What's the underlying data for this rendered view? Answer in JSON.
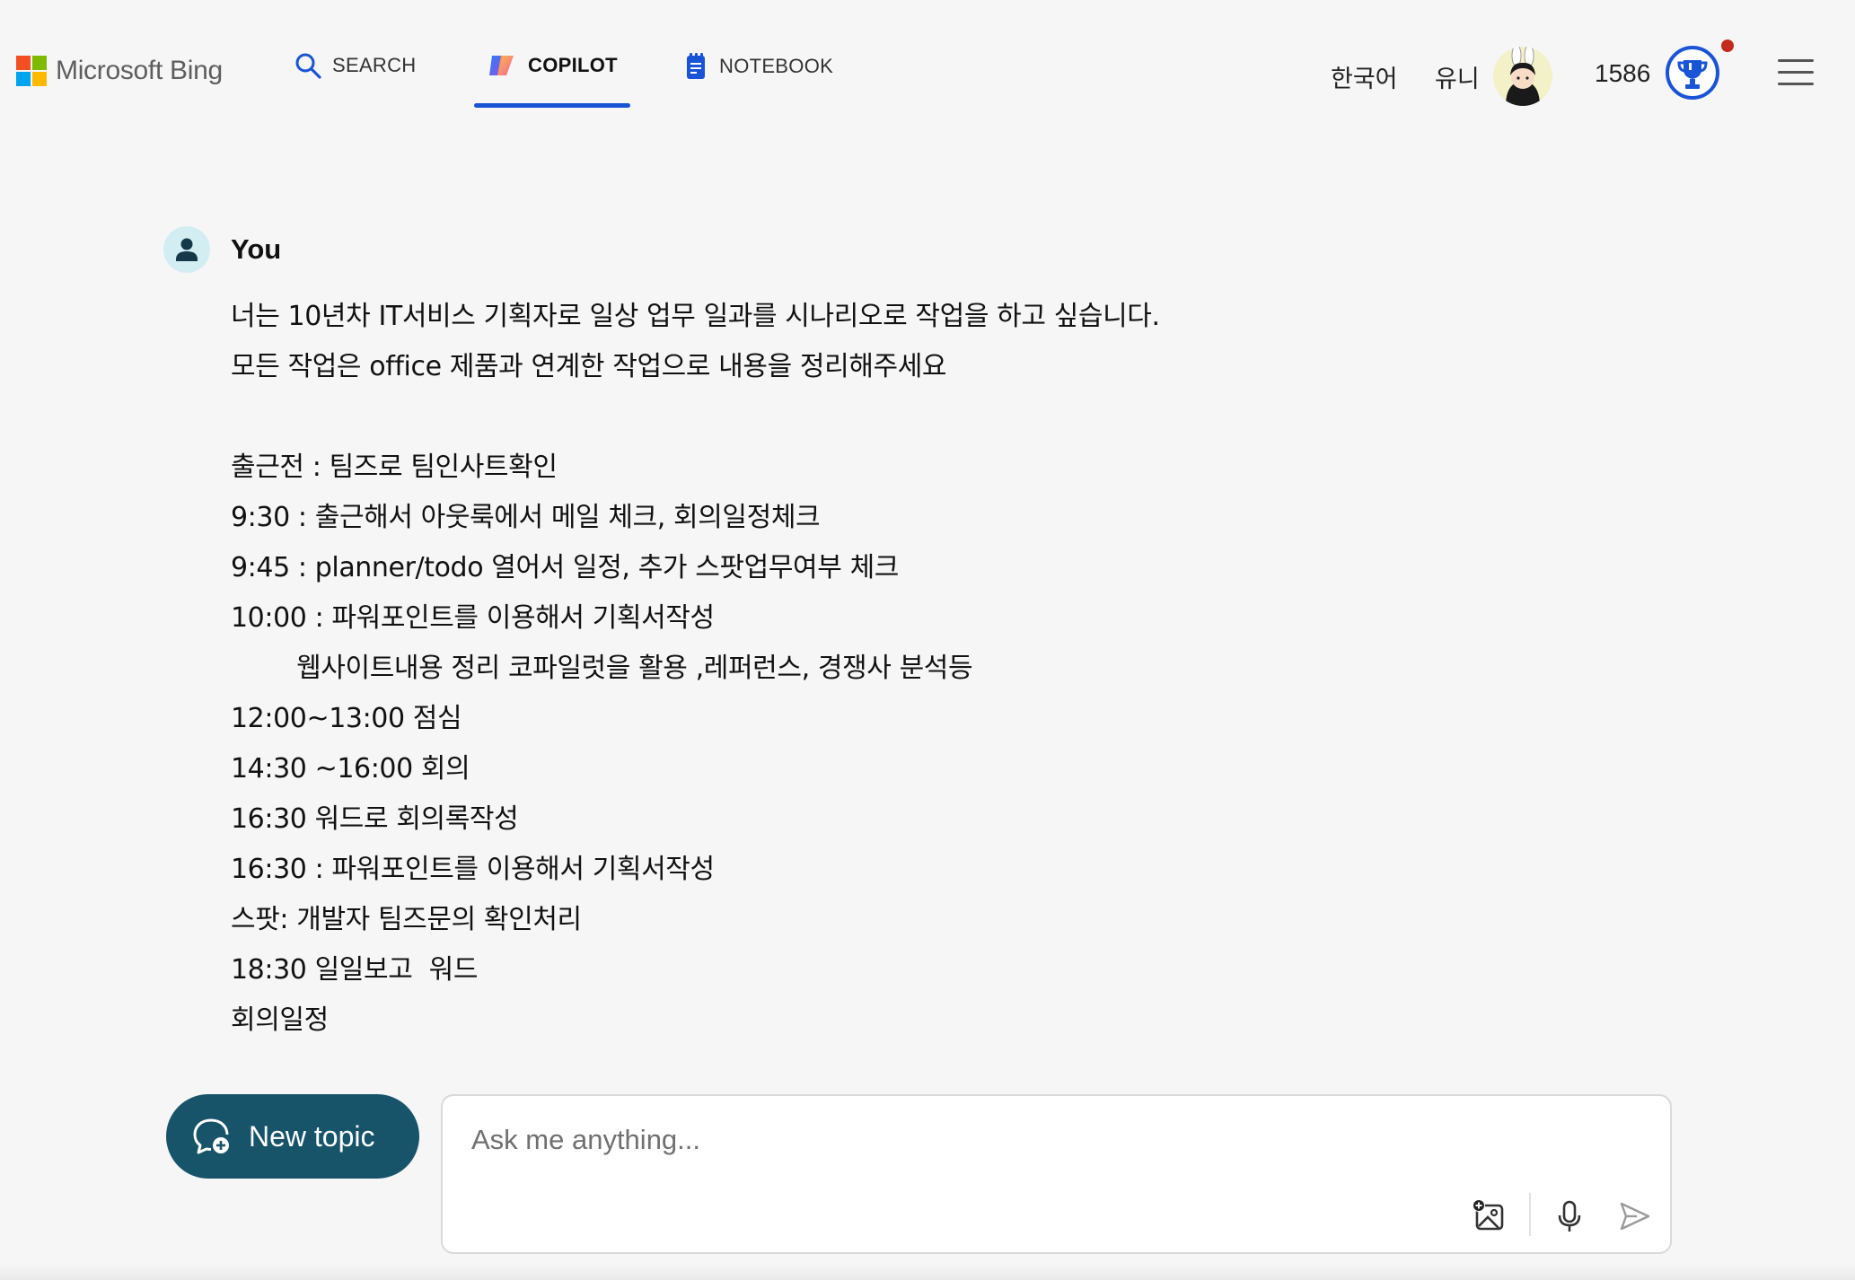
{
  "header": {
    "logo_text": "Microsoft Bing",
    "nav": [
      {
        "label": "SEARCH",
        "icon": "search-icon"
      },
      {
        "label": "COPILOT",
        "icon": "copilot-icon",
        "active": true
      },
      {
        "label": "NOTEBOOK",
        "icon": "notebook-icon"
      }
    ],
    "language": "한국어",
    "username": "유니",
    "points": "1586"
  },
  "message": {
    "author": "You",
    "lines": [
      "너는 10년차 IT서비스 기획자로 일상 업무 일과를 시나리오로 작업을 하고 싶습니다.",
      "모든 작업은 office 제품과 연계한 작업으로 내용을 정리해주세요",
      "",
      "출근전 : 팀즈로 팀인사트확인",
      "9:30 : 출근해서 아웃룩에서 메일 체크, 회의일정체크",
      "9:45 : planner/todo 열어서 일정, 추가 스팟업무여부 체크",
      "10:00 : 파워포인트를 이용해서 기획서작성",
      "        웹사이트내용 정리 코파일럿을 활용 ,레퍼런스, 경쟁사 분석등",
      "12:00~13:00 점심",
      "14:30 ~16:00 회의",
      "16:30 워드로 회의록작성",
      "16:30 : 파워포인트를 이용해서 기획서작성",
      "스팟: 개발자 팀즈문의 확인처리",
      "18:30 일일보고  워드",
      "회의일정"
    ]
  },
  "composer": {
    "new_topic_label": "New topic",
    "placeholder": "Ask me anything...",
    "value": ""
  },
  "colors": {
    "accent": "#1a54d6",
    "new_topic_bg": "#17546a",
    "background": "#f6f6f6",
    "notification_dot": "#c42b1c"
  }
}
